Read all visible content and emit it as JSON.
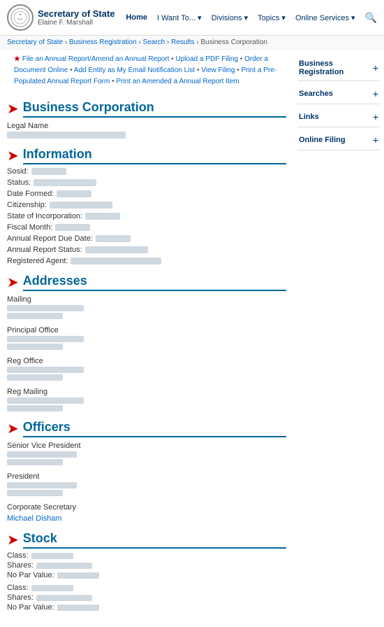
{
  "header": {
    "logo_text": "SOS",
    "title_main": "Secretary of State",
    "title_sub": "Elaine F. Marshall",
    "nav": [
      {
        "label": "Home",
        "active": true
      },
      {
        "label": "I Want To...",
        "dropdown": true
      },
      {
        "label": "Divisions",
        "dropdown": true
      },
      {
        "label": "Topics",
        "dropdown": true
      },
      {
        "label": "Online Services",
        "dropdown": true
      }
    ]
  },
  "breadcrumb": {
    "items": [
      "Secretary of State",
      "Business Registration",
      "Search",
      "Results",
      "Business Corporation"
    ]
  },
  "action_links": {
    "links": [
      "File an Annual Report/Amend an Annual Report",
      "Upload a PDF Filing",
      "Order a Document Online",
      "Add Entity as My Email Notification List",
      "View Filing",
      "Print a Pre-Populated Annual Report Form",
      "Print an Amended a Annual Report Item"
    ]
  },
  "sections": {
    "business_corporation": {
      "title": "Business Corporation",
      "legal_name_label": "Legal Name"
    },
    "information": {
      "title": "Information",
      "fields": [
        {
          "label": "Sosid:"
        },
        {
          "label": "Status:"
        },
        {
          "label": "Date Formed:"
        },
        {
          "label": "Citizenship:"
        },
        {
          "label": "State of Incorporation:"
        },
        {
          "label": "Fiscal Month:"
        },
        {
          "label": "Annual Report Due Date:"
        },
        {
          "label": "Annual Report Status:"
        },
        {
          "label": "Registered Agent:"
        }
      ]
    },
    "addresses": {
      "title": "Addresses",
      "types": [
        "Mailing",
        "Principal Office",
        "Reg Office",
        "Reg Mailing"
      ]
    },
    "officers": {
      "title": "Officers",
      "roles": [
        "Senior Vice President",
        "President",
        "Corporate Secretary"
      ],
      "corporate_secretary_names": [
        "Michael",
        "Disham"
      ]
    },
    "stock": {
      "title": "Stock",
      "rows": [
        {
          "label": "Class:"
        },
        {
          "label": "Shares:"
        },
        {
          "label": "No Par Value:"
        },
        {
          "label": "Class:"
        },
        {
          "label": "Shares:"
        },
        {
          "label": "No Par Value:"
        }
      ]
    }
  },
  "sidebar": {
    "sections": [
      {
        "label": "Business Registration"
      },
      {
        "label": "Searches"
      },
      {
        "label": "Links"
      },
      {
        "label": "Online Filing"
      }
    ]
  }
}
